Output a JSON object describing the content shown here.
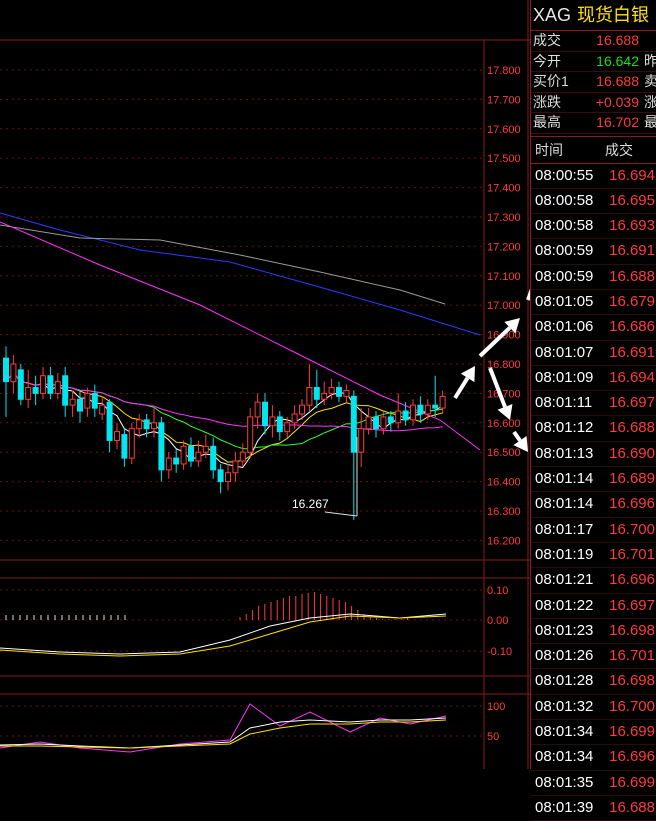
{
  "panel": {
    "symbol": "XAG",
    "name": "现货白银",
    "quotes": [
      {
        "label": "成交",
        "value": "16.688",
        "color": "red",
        "label2": ""
      },
      {
        "label": "今开",
        "value": "16.642",
        "color": "green",
        "label2": "昨"
      },
      {
        "label": "买价1",
        "value": "16.688",
        "color": "red",
        "label2": "卖"
      },
      {
        "label": "涨跌",
        "value": "+0.039",
        "color": "red",
        "label2": "涨"
      },
      {
        "label": "最高",
        "value": "16.702",
        "color": "red",
        "label2": "最"
      }
    ],
    "table_header": {
      "time": "时间",
      "price": "成交"
    },
    "ticks": [
      {
        "time": "08:00:55",
        "price": "16.694"
      },
      {
        "time": "08:00:58",
        "price": "16.695"
      },
      {
        "time": "08:00:58",
        "price": "16.693"
      },
      {
        "time": "08:00:59",
        "price": "16.691"
      },
      {
        "time": "08:00:59",
        "price": "16.688"
      },
      {
        "time": "08:01:05",
        "price": "16.679"
      },
      {
        "time": "08:01:06",
        "price": "16.686"
      },
      {
        "time": "08:01:07",
        "price": "16.691"
      },
      {
        "time": "08:01:09",
        "price": "16.694"
      },
      {
        "time": "08:01:11",
        "price": "16.697"
      },
      {
        "time": "08:01:12",
        "price": "16.688"
      },
      {
        "time": "08:01:13",
        "price": "16.690"
      },
      {
        "time": "08:01:14",
        "price": "16.689"
      },
      {
        "time": "08:01:14",
        "price": "16.696"
      },
      {
        "time": "08:01:17",
        "price": "16.700"
      },
      {
        "time": "08:01:19",
        "price": "16.701"
      },
      {
        "time": "08:01:21",
        "price": "16.696"
      },
      {
        "time": "08:01:22",
        "price": "16.697"
      },
      {
        "time": "08:01:23",
        "price": "16.698"
      },
      {
        "time": "08:01:26",
        "price": "16.701"
      },
      {
        "time": "08:01:28",
        "price": "16.698"
      },
      {
        "time": "08:01:32",
        "price": "16.700"
      },
      {
        "time": "08:01:34",
        "price": "16.699"
      },
      {
        "time": "08:01:34",
        "price": "16.696"
      },
      {
        "time": "08:01:35",
        "price": "16.699"
      },
      {
        "time": "08:01:39",
        "price": "16.688"
      }
    ]
  },
  "chart": {
    "price_axis": [
      "17.800",
      "17.700",
      "17.600",
      "17.500",
      "17.400",
      "17.300",
      "17.200",
      "17.100",
      "17.000",
      "16.900",
      "16.800",
      "16.700",
      "16.600",
      "16.500",
      "16.400",
      "16.300",
      "16.200"
    ],
    "low_annotation": "16.267",
    "macd_axis": [
      "0.10",
      "0.00",
      "-0.10"
    ],
    "kdj_axis": [
      "100",
      "50"
    ],
    "candles": [
      {
        "o": 16.82,
        "c": 16.74,
        "h": 16.86,
        "l": 16.62
      },
      {
        "o": 16.74,
        "c": 16.8,
        "h": 16.83,
        "l": 16.7
      },
      {
        "o": 16.78,
        "c": 16.68,
        "h": 16.8,
        "l": 16.66
      },
      {
        "o": 16.68,
        "c": 16.72,
        "h": 16.78,
        "l": 16.65
      },
      {
        "o": 16.72,
        "c": 16.7,
        "h": 16.76,
        "l": 16.66
      },
      {
        "o": 16.7,
        "c": 16.76,
        "h": 16.79,
        "l": 16.68
      },
      {
        "o": 16.76,
        "c": 16.7,
        "h": 16.79,
        "l": 16.68
      },
      {
        "o": 16.7,
        "c": 16.74,
        "h": 16.77,
        "l": 16.68
      },
      {
        "o": 16.76,
        "c": 16.66,
        "h": 16.79,
        "l": 16.62
      },
      {
        "o": 16.66,
        "c": 16.68,
        "h": 16.71,
        "l": 16.62
      },
      {
        "o": 16.68,
        "c": 16.64,
        "h": 16.71,
        "l": 16.6
      },
      {
        "o": 16.65,
        "c": 16.7,
        "h": 16.72,
        "l": 16.62
      },
      {
        "o": 16.7,
        "c": 16.65,
        "h": 16.73,
        "l": 16.62
      },
      {
        "o": 16.63,
        "c": 16.66,
        "h": 16.69,
        "l": 16.61
      },
      {
        "o": 16.67,
        "c": 16.54,
        "h": 16.68,
        "l": 16.5
      },
      {
        "o": 16.54,
        "c": 16.57,
        "h": 16.6,
        "l": 16.51
      },
      {
        "o": 16.56,
        "c": 16.48,
        "h": 16.58,
        "l": 16.45
      },
      {
        "o": 16.48,
        "c": 16.58,
        "h": 16.6,
        "l": 16.46
      },
      {
        "o": 16.58,
        "c": 16.61,
        "h": 16.63,
        "l": 16.55
      },
      {
        "o": 16.61,
        "c": 16.58,
        "h": 16.63,
        "l": 16.55
      },
      {
        "o": 16.58,
        "c": 16.6,
        "h": 16.65,
        "l": 16.55
      },
      {
        "o": 16.6,
        "c": 16.44,
        "h": 16.62,
        "l": 16.4
      },
      {
        "o": 16.44,
        "c": 16.48,
        "h": 16.5,
        "l": 16.41
      },
      {
        "o": 16.48,
        "c": 16.46,
        "h": 16.51,
        "l": 16.43
      },
      {
        "o": 16.46,
        "c": 16.52,
        "h": 16.54,
        "l": 16.44
      },
      {
        "o": 16.52,
        "c": 16.47,
        "h": 16.55,
        "l": 16.45
      },
      {
        "o": 16.47,
        "c": 16.5,
        "h": 16.54,
        "l": 16.45
      },
      {
        "o": 16.5,
        "c": 16.52,
        "h": 16.56,
        "l": 16.48
      },
      {
        "o": 16.52,
        "c": 16.44,
        "h": 16.55,
        "l": 16.41
      },
      {
        "o": 16.44,
        "c": 16.4,
        "h": 16.46,
        "l": 16.36
      },
      {
        "o": 16.4,
        "c": 16.43,
        "h": 16.46,
        "l": 16.37
      },
      {
        "o": 16.43,
        "c": 16.47,
        "h": 16.5,
        "l": 16.4
      },
      {
        "o": 16.47,
        "c": 16.5,
        "h": 16.53,
        "l": 16.45
      },
      {
        "o": 16.5,
        "c": 16.62,
        "h": 16.65,
        "l": 16.48
      },
      {
        "o": 16.62,
        "c": 16.67,
        "h": 16.7,
        "l": 16.58
      },
      {
        "o": 16.67,
        "c": 16.59,
        "h": 16.7,
        "l": 16.56
      },
      {
        "o": 16.59,
        "c": 16.62,
        "h": 16.66,
        "l": 16.55
      },
      {
        "o": 16.62,
        "c": 16.57,
        "h": 16.64,
        "l": 16.54
      },
      {
        "o": 16.57,
        "c": 16.6,
        "h": 16.62,
        "l": 16.55
      },
      {
        "o": 16.6,
        "c": 16.63,
        "h": 16.66,
        "l": 16.58
      },
      {
        "o": 16.63,
        "c": 16.66,
        "h": 16.68,
        "l": 16.61
      },
      {
        "o": 16.66,
        "c": 16.72,
        "h": 16.8,
        "l": 16.64
      },
      {
        "o": 16.72,
        "c": 16.68,
        "h": 16.78,
        "l": 16.65
      },
      {
        "o": 16.68,
        "c": 16.7,
        "h": 16.74,
        "l": 16.66
      },
      {
        "o": 16.7,
        "c": 16.72,
        "h": 16.75,
        "l": 16.68
      },
      {
        "o": 16.72,
        "c": 16.69,
        "h": 16.74,
        "l": 16.67
      },
      {
        "o": 16.69,
        "c": 16.71,
        "h": 16.73,
        "l": 16.67
      },
      {
        "o": 16.69,
        "c": 16.5,
        "h": 16.71,
        "l": 16.27
      },
      {
        "o": 16.5,
        "c": 16.58,
        "h": 16.65,
        "l": 16.45
      },
      {
        "o": 16.58,
        "c": 16.62,
        "h": 16.65,
        "l": 16.56
      },
      {
        "o": 16.62,
        "c": 16.58,
        "h": 16.64,
        "l": 16.55
      },
      {
        "o": 16.58,
        "c": 16.62,
        "h": 16.64,
        "l": 16.56
      },
      {
        "o": 16.62,
        "c": 16.6,
        "h": 16.64,
        "l": 16.57
      },
      {
        "o": 16.6,
        "c": 16.64,
        "h": 16.7,
        "l": 16.58
      },
      {
        "o": 16.64,
        "c": 16.61,
        "h": 16.67,
        "l": 16.59
      },
      {
        "o": 16.61,
        "c": 16.66,
        "h": 16.68,
        "l": 16.59
      },
      {
        "o": 16.66,
        "c": 16.63,
        "h": 16.69,
        "l": 16.6
      },
      {
        "o": 16.63,
        "c": 16.66,
        "h": 16.68,
        "l": 16.61
      },
      {
        "o": 16.66,
        "c": 16.65,
        "h": 16.76,
        "l": 16.62
      },
      {
        "o": 16.65,
        "c": 16.69,
        "h": 16.71,
        "l": 16.63
      }
    ]
  }
}
